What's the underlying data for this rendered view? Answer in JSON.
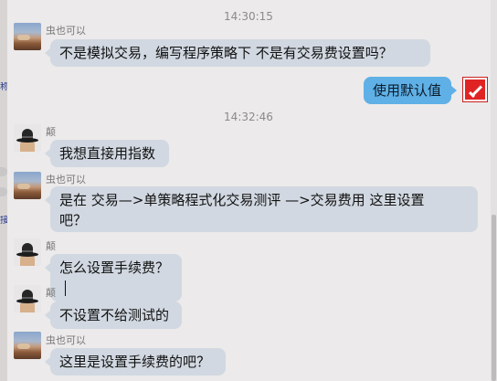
{
  "left_fragments": [
    "称",
    "接"
  ],
  "timestamps": [
    "14:30:15",
    "14:32:46"
  ],
  "messages": [
    {
      "sender": "虫也可以",
      "text": "不是模拟交易，编写程序策略下   不是有交易费设置吗？"
    },
    {
      "sender": "",
      "text": "使用默认值"
    },
    {
      "sender": "颠",
      "text": "我想直接用指数"
    },
    {
      "sender": "虫也可以",
      "line1": "是在  交易—>单策略程式化交易测评  —>交易费用      这里设置",
      "line2": "吧？"
    },
    {
      "sender": "颠",
      "text": "怎么设置手续费？"
    },
    {
      "sender": "颠",
      "text": "不设置不给测试的"
    },
    {
      "sender": "虫也可以",
      "text": "这里是设置手续费的吧？"
    }
  ],
  "icons": {
    "avatar_landscape": "landscape-avatar",
    "avatar_hat": "bowler-hat-avatar",
    "avatar_self": "red-brush-avatar"
  },
  "colors": {
    "background": "#eceaea",
    "incoming_bubble": "#d1d8e1",
    "outgoing_bubble": "#5fb0e6",
    "timestamp": "#8a8a8a"
  }
}
